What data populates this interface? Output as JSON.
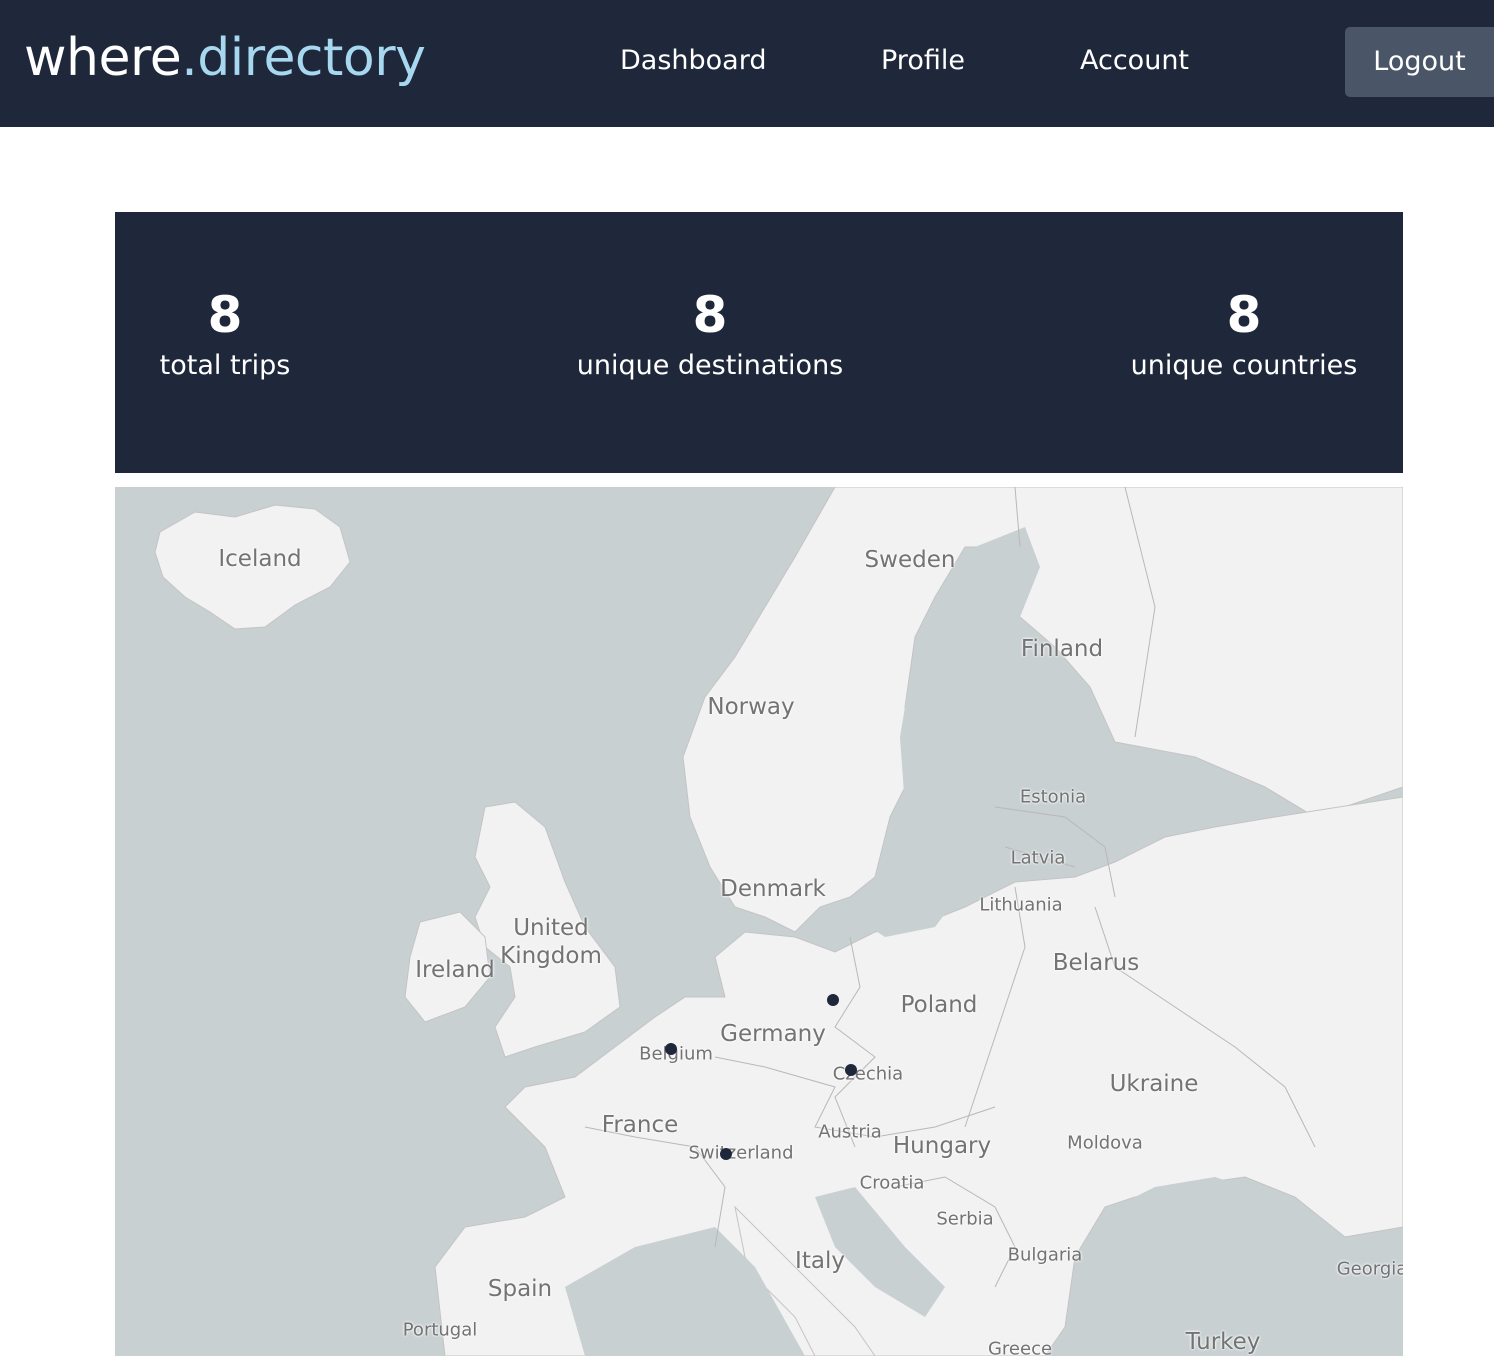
{
  "brand": {
    "part1": "where",
    "part2": ".directory"
  },
  "nav": {
    "dashboard": "Dashboard",
    "profile": "Profile",
    "account": "Account",
    "logout": "Logout"
  },
  "stats": [
    {
      "value": "8",
      "label": "total trips"
    },
    {
      "value": "8",
      "label": "unique destinations"
    },
    {
      "value": "8",
      "label": "unique countries"
    }
  ],
  "map": {
    "labels": {
      "iceland": "Iceland",
      "sweden": "Sweden",
      "finland": "Finland",
      "norway": "Norway",
      "estonia": "Estonia",
      "latvia": "Latvia",
      "lithuania": "Lithuania",
      "denmark": "Denmark",
      "united": "United",
      "kingdom": "Kingdom",
      "ireland": "Ireland",
      "belarus": "Belarus",
      "poland": "Poland",
      "germany": "Germany",
      "belgium": "Belgium",
      "czechia": "Czechia",
      "ukraine": "Ukraine",
      "france": "France",
      "austria": "Austria",
      "hungary": "Hungary",
      "moldova": "Moldova",
      "switzerland": "Switzerland",
      "croatia": "Croatia",
      "serbia": "Serbia",
      "bulgaria": "Bulgaria",
      "italy": "Italy",
      "spain": "Spain",
      "portugal": "Portugal",
      "georgia": "Georgia",
      "greece": "Greece",
      "turkey": "Turkey"
    },
    "colors": {
      "water": "#c8d0d2",
      "land": "#f2f2f2",
      "pin": "#1f283b"
    }
  }
}
